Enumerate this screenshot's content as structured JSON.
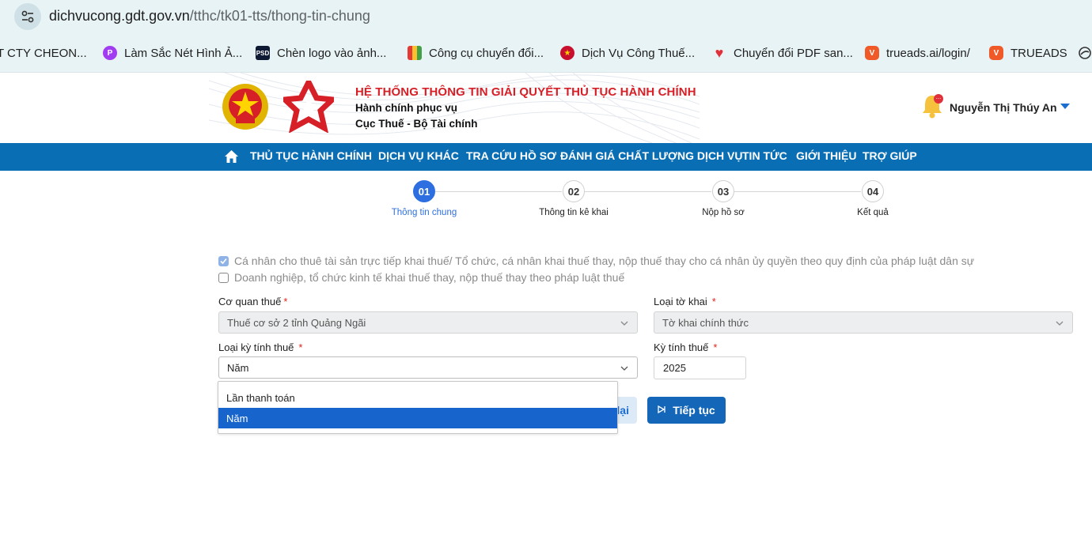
{
  "browser": {
    "url_host": "dichvucong.gdt.gov.vn",
    "url_path": "/tthc/tk01-tts/thong-tin-chung",
    "bookmarks": [
      {
        "label": "T CTY CHEON...",
        "icon": "none"
      },
      {
        "label": "Làm Sắc Nét Hình Ả...",
        "icon": "picsart-icon",
        "color": "#a13cf0"
      },
      {
        "label": "Chèn logo vào ảnh...",
        "icon": "psd-icon",
        "color": "#0e1a33"
      },
      {
        "label": "Công cụ chuyển đổi...",
        "icon": "colorgrid-icon",
        "color": "#f4a21a"
      },
      {
        "label": "Dịch Vụ Công Thuế...",
        "icon": "emblem-icon",
        "color": "#c8102e"
      },
      {
        "label": "Chuyển đổi PDF san...",
        "icon": "heart-icon",
        "color": "#e0303a"
      },
      {
        "label": "trueads.ai/login/",
        "icon": "trueads-icon",
        "color": "#f05a28"
      },
      {
        "label": "TRUEADS",
        "icon": "trueads-icon",
        "color": "#f05a28"
      }
    ]
  },
  "header": {
    "title": "HỆ THỐNG THÔNG TIN GIẢI QUYẾT THỦ TỤC HÀNH CHÍNH",
    "subtitle1": "Hành chính phục vụ",
    "subtitle2": "Cục Thuế - Bộ Tài chính",
    "user_name": "Nguyễn Thị Thúy An"
  },
  "nav": {
    "items": [
      "THỦ TỤC HÀNH CHÍNH",
      "DỊCH VỤ KHÁC",
      "TRA CỨU HỒ SƠ",
      "ĐÁNH GIÁ CHẤT LƯỢNG DỊCH VỤ",
      "TIN TỨC",
      "GIỚI THIỆU",
      "TRỢ GIÚP"
    ]
  },
  "steps": [
    {
      "num": "01",
      "label": "Thông tin chung",
      "active": true
    },
    {
      "num": "02",
      "label": "Thông tin kê khai",
      "active": false
    },
    {
      "num": "03",
      "label": "Nộp hồ sơ",
      "active": false
    },
    {
      "num": "04",
      "label": "Kết quả",
      "active": false
    }
  ],
  "options": {
    "opt1": {
      "label": "Cá nhân cho thuê tài sản trực tiếp khai thuế/ Tổ chức, cá nhân khai thuế thay, nộp thuế thay cho cá nhân ủy quyền theo quy định của pháp luật dân sự",
      "checked": true
    },
    "opt2": {
      "label": "Doanh nghiệp, tổ chức kinh tế khai thuế thay, nộp thuế thay theo pháp luật thuế",
      "checked": false
    }
  },
  "form": {
    "co_quan_thue": {
      "label": "Cơ quan thuế",
      "value": "Thuế cơ sở 2 tỉnh Quảng Ngãi"
    },
    "loai_to_khai": {
      "label": "Loại tờ khai",
      "value": "Tờ khai chính thức"
    },
    "loai_ky": {
      "label": "Loại kỳ tính thuế",
      "value": "Năm",
      "options": [
        "Lần thanh toán",
        "Năm"
      ]
    },
    "ky_tinh_thue": {
      "label": "Kỳ tính thuế",
      "value": "2025"
    },
    "required_mark": "*"
  },
  "buttons": {
    "back": "lại",
    "next": "Tiếp tục"
  }
}
